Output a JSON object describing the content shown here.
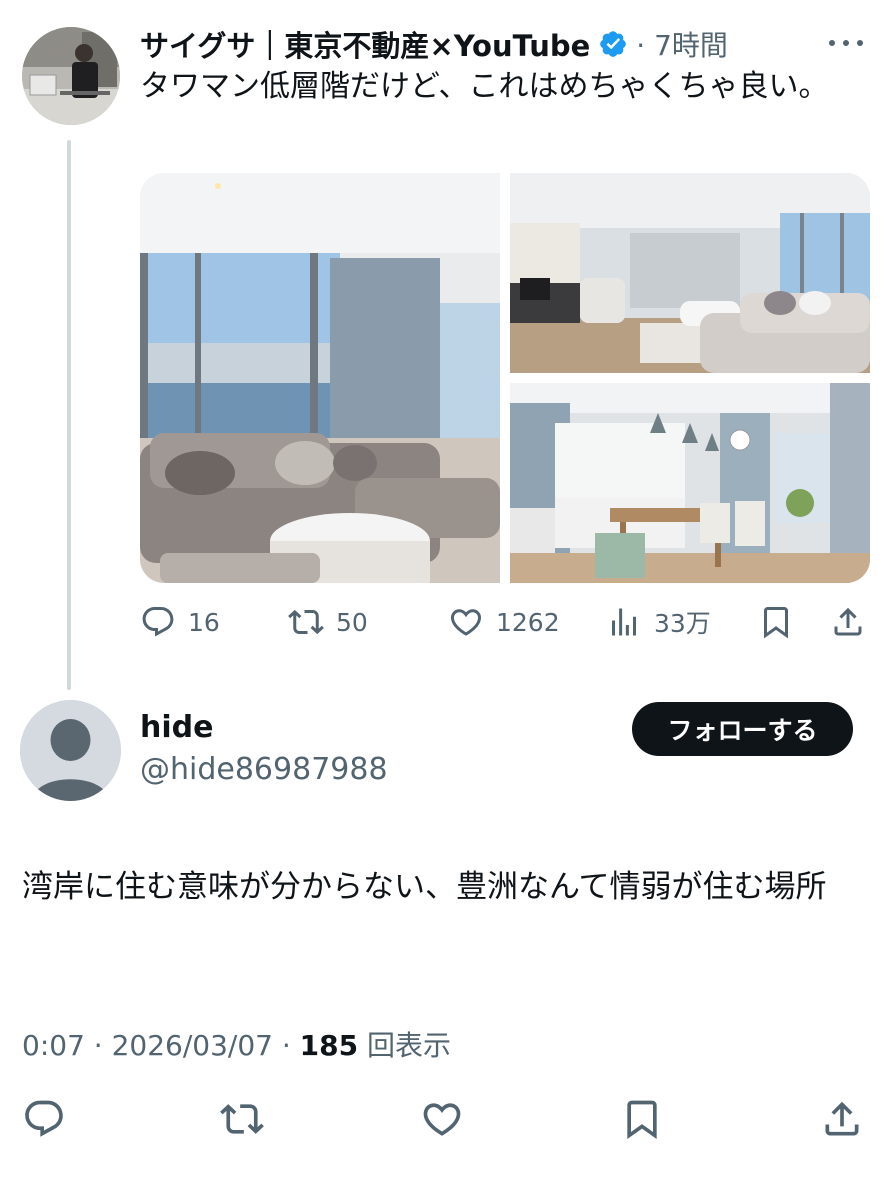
{
  "parent": {
    "author_name": "サイグサ｜東京不動産×YouTube",
    "meta": "· 7時間",
    "text": "タワマン低層階だけど、これはめちゃくちゃ良い。",
    "icons": [
      "verified-badge-icon",
      "more-icon",
      "reply-icon",
      "retweet-icon",
      "like-icon",
      "views-icon",
      "bookmark-icon",
      "share-icon"
    ],
    "actions": {
      "replies": "16",
      "retweets": "50",
      "likes": "1262",
      "views": "33万"
    }
  },
  "reply": {
    "author_name": "hide",
    "handle": "@hide86987988",
    "follow_label": "フォローする",
    "text": "湾岸に住む意味が分からない、豊洲なんて情弱が住む場所",
    "time_date": "0:07 · 2026/03/07 · ",
    "views_count": "185",
    "views_label": " 回表示",
    "icons": [
      "reply-icon",
      "retweet-icon",
      "like-icon",
      "bookmark-icon",
      "share-icon"
    ]
  },
  "colors": {
    "text_primary": "#0f1419",
    "text_secondary": "#536471",
    "verified_blue": "#1d9bf0",
    "thread_line": "#cfd9de",
    "follow_button_bg": "#0f1419"
  }
}
